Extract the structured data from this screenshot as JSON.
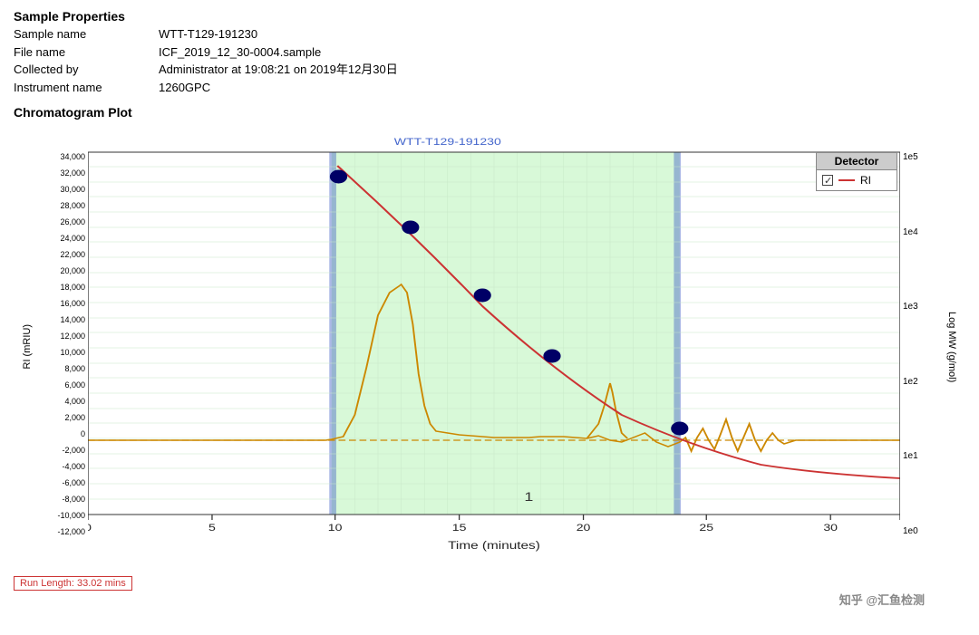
{
  "properties": {
    "title": "Sample Properties",
    "rows": [
      {
        "label": "Sample name",
        "value": "WTT-T129-191230"
      },
      {
        "label": "File name",
        "value": "ICF_2019_12_30-0004.sample"
      },
      {
        "label": "Collected by",
        "value": "Administrator at 19:08:21 on 2019年12月30日"
      },
      {
        "label": "Instrument name",
        "value": "1260GPC"
      }
    ]
  },
  "chart": {
    "section_title": "Chromatogram Plot",
    "sample_label": "WTT-T129-191230",
    "y_axis_left_label": "RI (mRIU)",
    "y_axis_right_label": "Log MW (g/mol)",
    "x_axis_label": "Time (minutes)",
    "y_left_ticks": [
      "34,000",
      "32,000",
      "30,000",
      "28,000",
      "26,000",
      "24,000",
      "22,000",
      "20,000",
      "18,000",
      "16,000",
      "14,000",
      "12,000",
      "10,000",
      "8,000",
      "6,000",
      "4,000",
      "2,000",
      "0",
      "-2,000",
      "-4,000",
      "-6,000",
      "-8,000",
      "-10,000",
      "-12,000"
    ],
    "y_right_ticks": [
      "1e5",
      "1e4",
      "1e3",
      "1e2",
      "1e1",
      "1e0"
    ],
    "x_ticks": [
      "0",
      "5",
      "10",
      "15",
      "20",
      "25",
      "30"
    ],
    "peak_number": "1",
    "run_length": "Run Length: 33.02 mins"
  },
  "legend": {
    "title": "Detector",
    "items": [
      {
        "label": "RI",
        "checked": true
      }
    ]
  },
  "watermark": "知乎 @汇鱼检测"
}
